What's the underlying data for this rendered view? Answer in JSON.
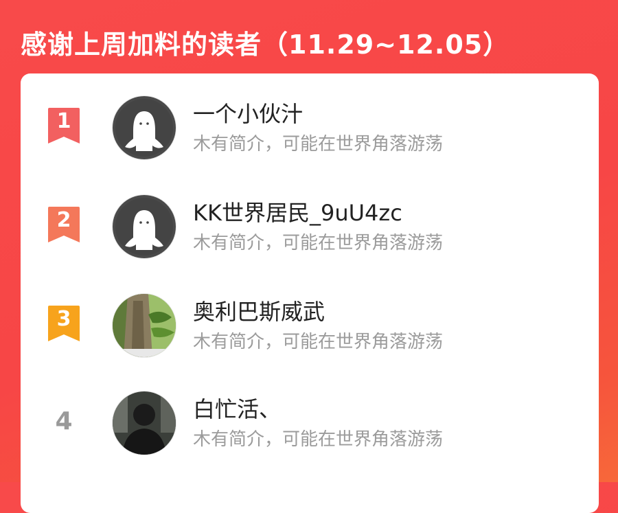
{
  "header": {
    "title": "感谢上周加料的读者（11.29~12.05）"
  },
  "colors": {
    "rank1": "#f26060",
    "rank2": "#f4785a",
    "rank3": "#f7a31c",
    "rank_plain": "#9a9a9a"
  },
  "readers": [
    {
      "rank": "1",
      "name": "一个小伙汁",
      "desc": "木有简介，可能在世界角落游荡",
      "avatar": "default-ghost-avatar"
    },
    {
      "rank": "2",
      "name": "KK世界居民_9uU4zc",
      "desc": "木有简介，可能在世界角落游荡",
      "avatar": "default-ghost-avatar"
    },
    {
      "rank": "3",
      "name": "奥利巴斯威武",
      "desc": "木有简介，可能在世界角落游荡",
      "avatar": "tree-photo-avatar"
    },
    {
      "rank": "4",
      "name": "白忙活、",
      "desc": "木有简介，可能在世界角落游荡",
      "avatar": "dark-portrait-avatar"
    }
  ]
}
